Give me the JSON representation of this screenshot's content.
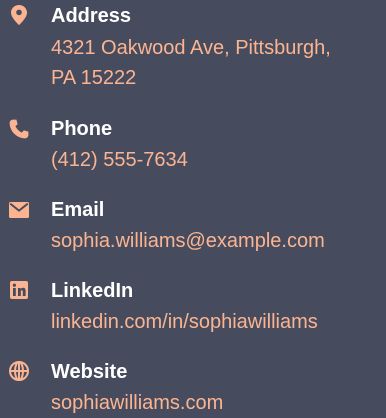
{
  "contact": {
    "accent_color": "#fbb492",
    "background_color": "#464c5d",
    "items": [
      {
        "icon": "map-pin-icon",
        "label": "Address",
        "value_line1": "4321 Oakwood Ave, Pittsburgh,",
        "value_line2": "PA 15222"
      },
      {
        "icon": "phone-icon",
        "label": "Phone",
        "value": "(412) 555-7634"
      },
      {
        "icon": "envelope-icon",
        "label": "Email",
        "value": "sophia.williams@example.com"
      },
      {
        "icon": "linkedin-icon",
        "label": "LinkedIn",
        "value": "linkedin.com/in/sophiawilliams"
      },
      {
        "icon": "globe-icon",
        "label": "Website",
        "value": "sophiawilliams.com"
      }
    ]
  }
}
